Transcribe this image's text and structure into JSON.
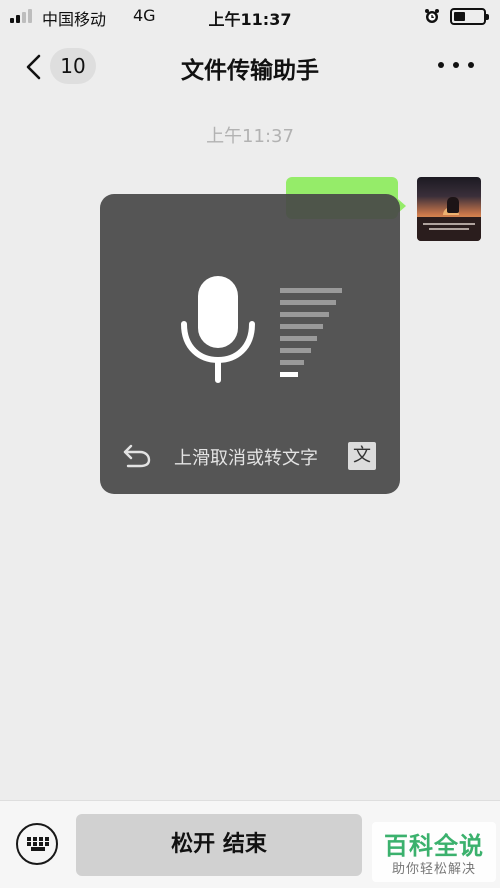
{
  "status_bar": {
    "carrier": "中国移动",
    "network": "4G",
    "time": "上午11:37",
    "signal_icon": "signal-bars-icon",
    "alarm_icon": "alarm-clock-icon",
    "battery_icon": "battery-icon"
  },
  "nav": {
    "back_icon": "chevron-left-icon",
    "unread_count": "10",
    "title": "文件传输助手",
    "more_icon": "more-dots-icon"
  },
  "chat": {
    "timestamp": "上午11:37",
    "bubble_color": "#95ec69"
  },
  "voice_overlay": {
    "mic_icon": "microphone-icon",
    "cancel_icon": "undo-arrow-icon",
    "hint": "上滑取消或转文字",
    "to_text_label": "文",
    "volume_bars_total": 8,
    "volume_bars_active": 1
  },
  "bottom_bar": {
    "keyboard_icon": "keyboard-icon",
    "hold_button_label": "松开 结束"
  },
  "watermark": {
    "title": "百科全说",
    "subtitle": "助你轻松解决"
  }
}
